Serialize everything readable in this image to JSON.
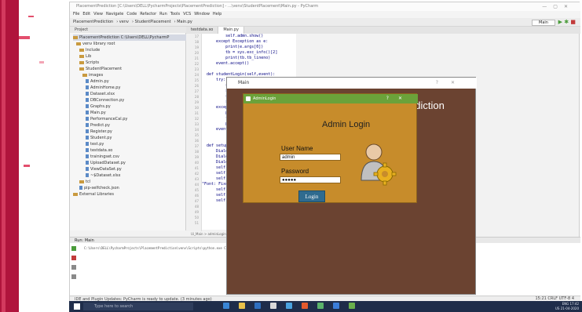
{
  "ide": {
    "title": "PlacementPrediction [C:\\Users\\DELL\\PycharmProjects\\PlacementPrediction] - ...\\venv\\StudentPlacement\\Main.py - PyCharm",
    "menu": [
      "File",
      "Edit",
      "View",
      "Navigate",
      "Code",
      "Refactor",
      "Run",
      "Tools",
      "VCS",
      "Window",
      "Help"
    ],
    "breadcrumb": [
      "PlacementPrediction",
      "venv",
      "StudentPlacement",
      "Main.py"
    ],
    "run_config": "Main",
    "project_header": "Project",
    "tree": [
      {
        "label": "PlacementPrediction  C:\\Users\\DELL\\PycharmP",
        "kind": "folder",
        "selected": true
      },
      {
        "label": "venv  library root",
        "kind": "folder"
      },
      {
        "label": "Include",
        "kind": "folder"
      },
      {
        "label": "Lib",
        "kind": "folder"
      },
      {
        "label": "Scripts",
        "kind": "folder"
      },
      {
        "label": "StudentPlacement",
        "kind": "folder"
      },
      {
        "label": "images",
        "kind": "folder"
      },
      {
        "label": "Admin.py",
        "kind": "file"
      },
      {
        "label": "AdminHome.py",
        "kind": "file"
      },
      {
        "label": "Dataset.xlsx",
        "kind": "file"
      },
      {
        "label": "DBConnection.py",
        "kind": "file"
      },
      {
        "label": "Graphs.py",
        "kind": "file"
      },
      {
        "label": "Main.py",
        "kind": "file"
      },
      {
        "label": "PerformanceCal.py",
        "kind": "file"
      },
      {
        "label": "Predict.py",
        "kind": "file"
      },
      {
        "label": "Register.py",
        "kind": "file"
      },
      {
        "label": "Student.py",
        "kind": "file"
      },
      {
        "label": "test.py",
        "kind": "file"
      },
      {
        "label": "testdata.xo",
        "kind": "file"
      },
      {
        "label": "trainingset.csv",
        "kind": "file"
      },
      {
        "label": "UploadDataset.py",
        "kind": "file"
      },
      {
        "label": "ViewDataSet.py",
        "kind": "file"
      },
      {
        "label": "~$Dataset.xlsx",
        "kind": "file"
      },
      {
        "label": "tcl",
        "kind": "folder"
      },
      {
        "label": "pip-selfcheck.json",
        "kind": "file"
      },
      {
        "label": "External Libraries",
        "kind": "folder"
      }
    ],
    "tabs": [
      "testdata.xo",
      "Main.py"
    ],
    "line_numbers": [
      "17",
      "18",
      "19",
      "20",
      "21",
      "22",
      "23",
      "24",
      "25",
      "26",
      "27",
      "28",
      "29",
      "30",
      "31",
      "32",
      "33",
      "34",
      "35",
      "36",
      "37",
      "38",
      "39",
      "40",
      "41",
      "42",
      "43",
      "44",
      "45",
      "46",
      "47",
      "48",
      "49",
      "50",
      "51"
    ],
    "code_lines": [
      "          self.admn.show()",
      "      except Exception as e:",
      "          print(e.args[0])",
      "          tb = sys.exc_info()[2]",
      "          print(tb.tb_lineno)",
      "      event.accept()",
      "",
      "  def studentLogin(self,event):",
      "      try:",
      "          self.",
      "          self.",
      "          self.",
      "          self.",
      "      except E",
      "          print",
      "          tb =",
      "          print",
      "      event.acc",
      "",
      "",
      "  def setupUi(s",
      "      Dialog.se",
      "      Dialog.re",
      "      Dialog.se",
      "      self.labe",
      "      self.labe",
      "      self.labe",
      "\"Font: Fixe \\\"se",
      "      self.labe",
      "      self.stud",
      "      self.stud"
    ],
    "editor_crumbs": "Ui_Main  >  adminLogin()",
    "run_header": "Run:  Main",
    "cmdline": "C:\\Users\\DELL\\PycharmProjects\\PlacementPrediction\\venv\\Scripts\\python.exe C:/Users/DELL/PycharmProjects/PlacementPrediction/venv/StudentPlacement/Main.py",
    "status": "IDE and Plugin Updates: PyCharm is ready to update. (3 minutes ago)",
    "status_right": "15:21  CRLF  UTF-8  4"
  },
  "tk": {
    "title": "Main",
    "prediction_text": "ediction"
  },
  "admin": {
    "title": "AdminLogin",
    "heading": "Admin Login",
    "username_label": "User Name",
    "username_value": "admin",
    "password_label": "Password",
    "password_value": "●●●●●",
    "login_label": "Login"
  },
  "taskbar": {
    "search_placeholder": "Type here to search",
    "lang": "ENG",
    "region": "US",
    "time": "17:42",
    "date": "21-04-2020",
    "app_colors": [
      "#3a86d6",
      "#e8c14a",
      "#2f6fbf",
      "#d9d9d9",
      "#4aa3df",
      "#e35a2d",
      "#5bb36b",
      "#3b7dd8",
      "#6ab04c"
    ]
  },
  "colors": {
    "brand_red": "#b0143c",
    "tk_bg": "#6b4331",
    "dialog_bg": "#c78c2b",
    "dialog_title": "#6ba23a",
    "login_btn": "#2f6b8f"
  }
}
